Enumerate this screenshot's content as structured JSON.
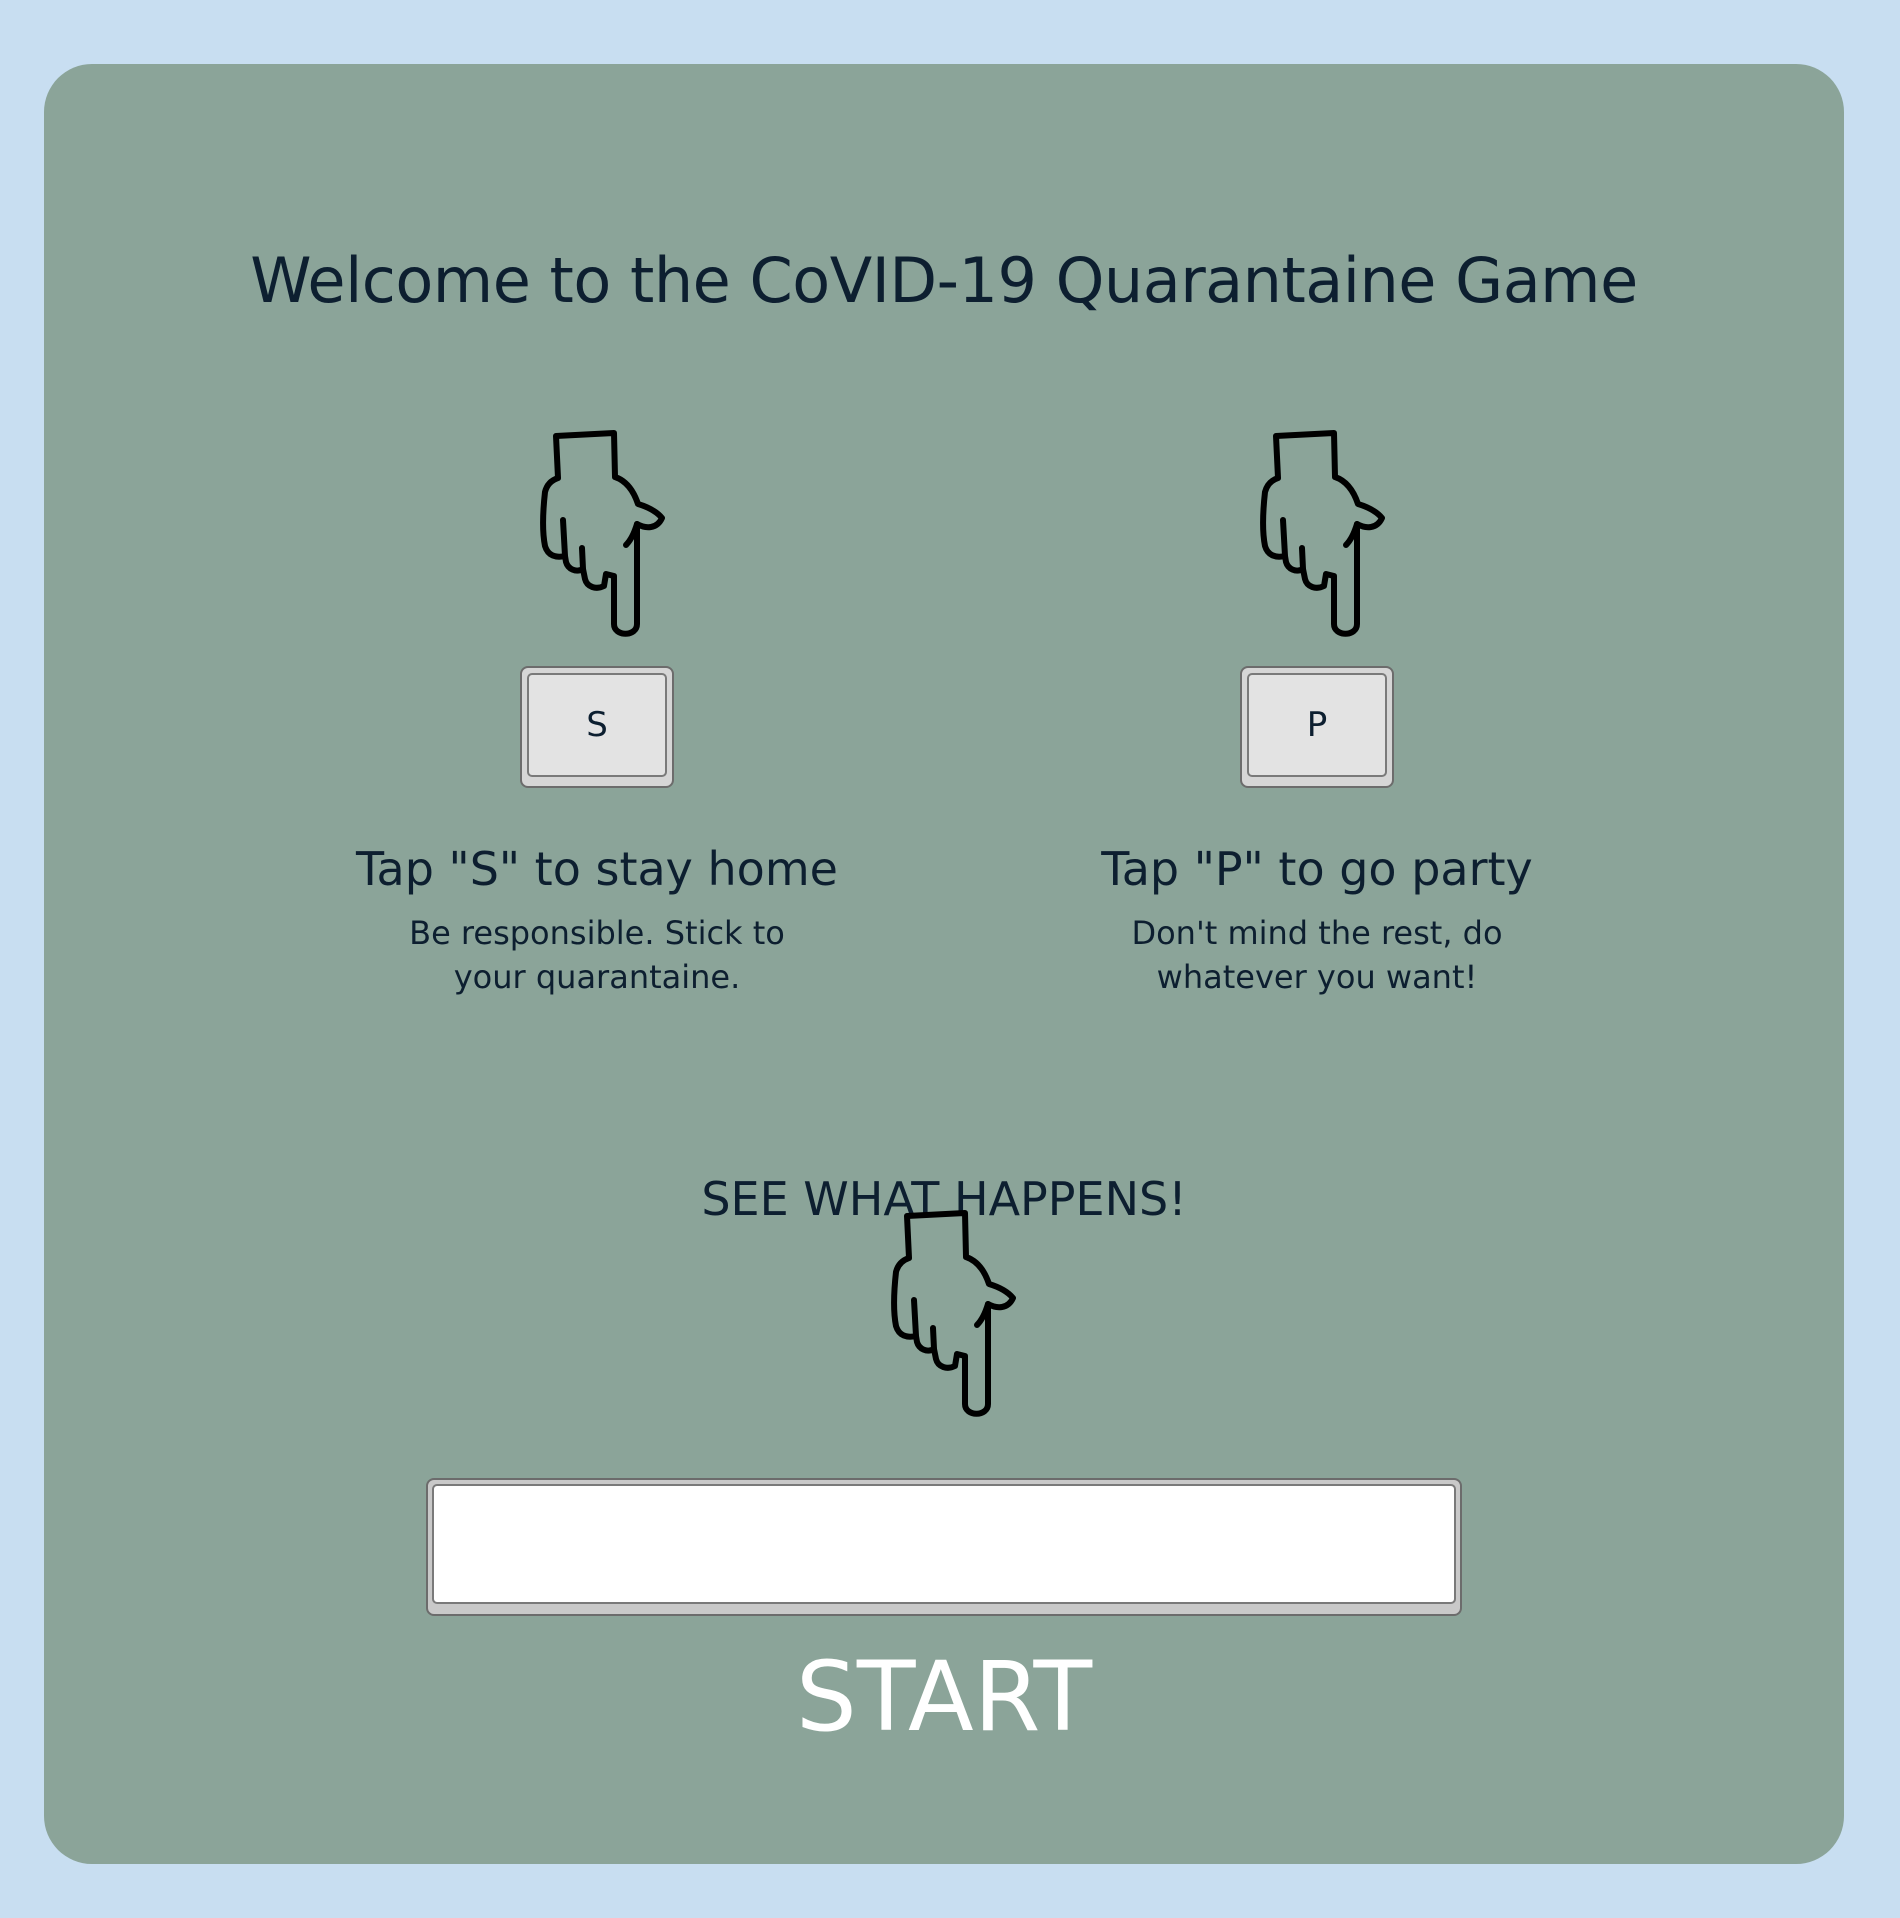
{
  "game": {
    "title": "Welcome to the CoVID-19 Quarantaine Game"
  },
  "options": [
    {
      "key": "S",
      "heading": "Tap \"S\" to stay home",
      "description": "Be responsible. Stick to your quarantaine.",
      "icon": "pointing-down-hand-icon"
    },
    {
      "key": "P",
      "heading": "Tap \"P\" to go party",
      "description": "Don't mind the rest, do whatever you want!",
      "icon": "pointing-down-hand-icon"
    }
  ],
  "start": {
    "prompt": "SEE WHAT HAPPENS!",
    "icon": "pointing-down-hand-icon",
    "label": "START",
    "field_value": ""
  },
  "colors": {
    "background": "#c8def1",
    "panel": "#8ba499",
    "text": "#0d1f30",
    "start_label": "#ffffff"
  }
}
